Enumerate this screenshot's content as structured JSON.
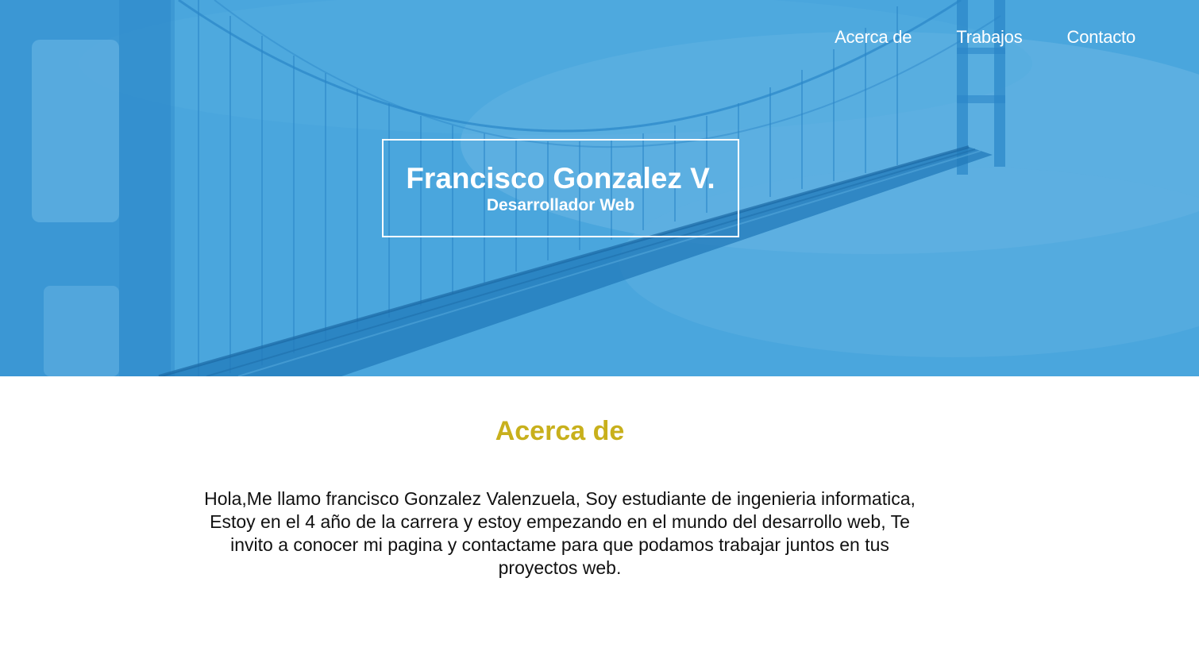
{
  "nav": {
    "items": [
      {
        "label": "Acerca de"
      },
      {
        "label": "Trabajos"
      },
      {
        "label": "Contacto"
      }
    ]
  },
  "hero": {
    "name": "Francisco Gonzalez V.",
    "role": "Desarrollador Web",
    "background": "bridge-photo"
  },
  "about": {
    "heading": "Acerca de",
    "text": "Hola,Me llamo francisco Gonzalez Valenzuela, Soy estudiante de ingenieria informatica, Estoy en el 4 año de la carrera y estoy empezando en el mundo del desarrollo web, Te invito a conocer mi pagina y contactame para que podamos trabajar juntos en tus proyectos web."
  },
  "colors": {
    "hero_blue": "#3d9ad6",
    "accent_gold": "#c8b01c",
    "text_dark": "#111111"
  }
}
